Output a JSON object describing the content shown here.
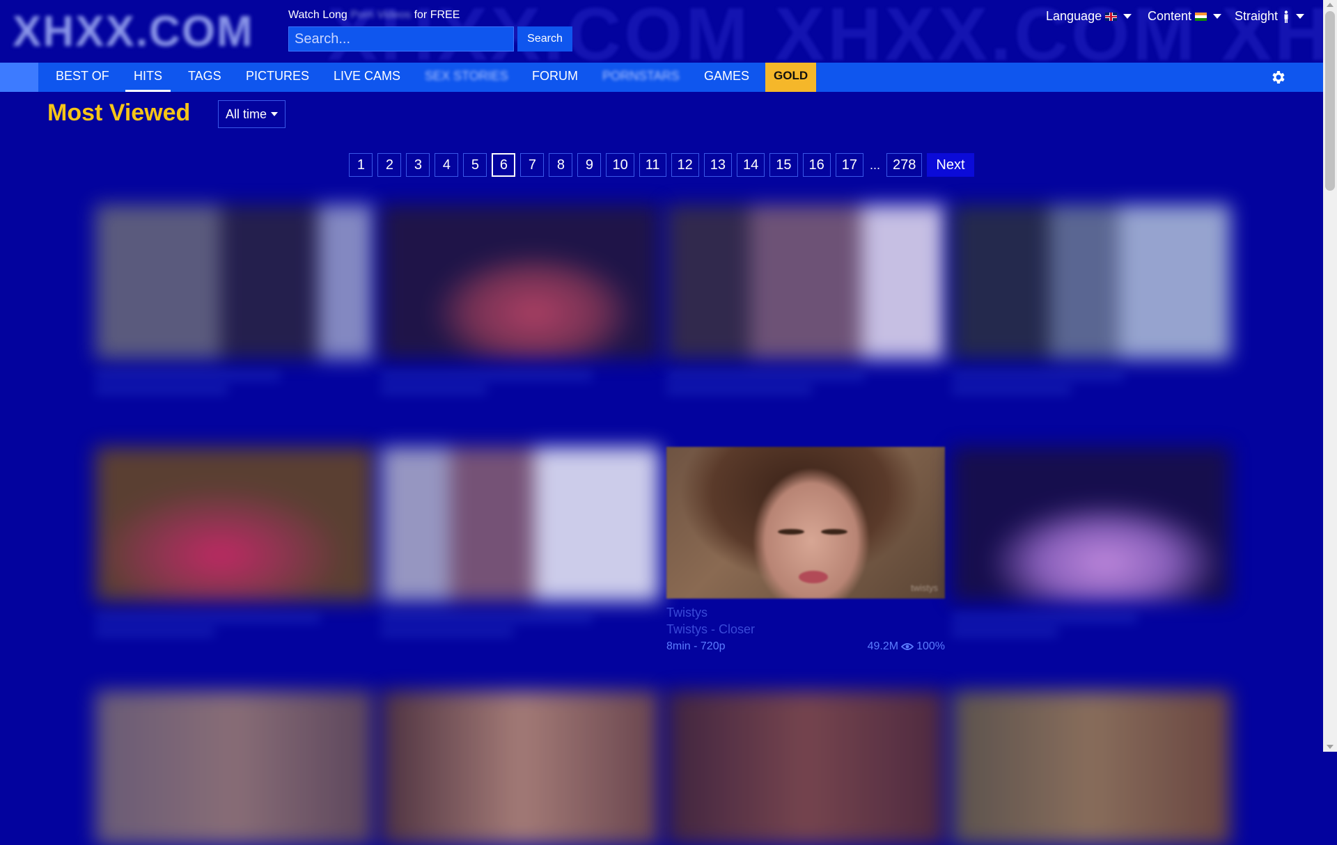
{
  "header": {
    "logo_text": "XHXX.COM",
    "watermark_text": "XHXX.COM XHXX.COM XHXX",
    "tagline_prefix": "Watch Long",
    "tagline_blurred": "Porn Videos",
    "tagline_suffix": "for FREE",
    "search_placeholder": "Search...",
    "search_button": "Search",
    "language_label": "Language",
    "content_label": "Content",
    "orientation_label": "Straight"
  },
  "nav": {
    "items": [
      "BEST OF",
      "HITS",
      "TAGS",
      "PICTURES",
      "LIVE CAMS",
      "SEX STORIES",
      "FORUM",
      "PORNSTARS",
      "GAMES"
    ],
    "gold": "GOLD",
    "active": "HITS"
  },
  "page": {
    "title": "Most Viewed",
    "period": "All time"
  },
  "pagination": {
    "pages": [
      "1",
      "2",
      "3",
      "4",
      "5",
      "6",
      "7",
      "8",
      "9",
      "10",
      "11",
      "12",
      "13",
      "14",
      "15",
      "16",
      "17"
    ],
    "active_page": "6",
    "dots": "...",
    "last": "278",
    "next": "Next"
  },
  "featured_video": {
    "channel": "Twistys",
    "title": "Twistys - Closer",
    "duration": "8min - 720p",
    "views": "49.2M",
    "rating": "100%"
  },
  "colors": {
    "background": "#03039e",
    "nav": "#0f56ee",
    "title": "#f5c518",
    "gold": "#f5b72a"
  }
}
